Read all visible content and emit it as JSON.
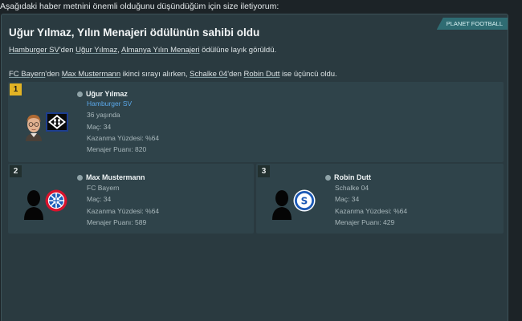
{
  "intro": "Aşağıdaki haber metnini önemli olduğunu düşündüğüm için size iletiyorum:",
  "source": "PLANET FOOTBALL",
  "headline": "Uğur Yılmaz, Yılın Menajeri ödülünün sahibi oldu",
  "para1": {
    "club": "Hamburger SV",
    "t1": "'den ",
    "manager": "Uğur Yılmaz",
    "t2": ", ",
    "award": "Almanya Yılın Menajeri",
    "t3": " ödülüne layık görüldü."
  },
  "para2": {
    "club1": "FC Bayern",
    "t1": "'den ",
    "manager1": "Max Mustermann",
    "t2": " ikinci sırayı alırken, ",
    "club2": "Schalke 04",
    "t3": "'den ",
    "manager2": "Robin Dutt",
    "t4": " ise üçüncü oldu."
  },
  "ranks": [
    {
      "rank": "1",
      "name": "Uğur Yılmaz",
      "club": "Hamburger SV",
      "age": "36 yaşında",
      "matches": "Maç: 34",
      "win_pct": "Kazanma Yüzdesi: %64",
      "rating": "Menajer Puanı: 820",
      "avatar_icon": "manager-face-icon",
      "crest_icon": "hamburger-sv-crest-icon"
    },
    {
      "rank": "2",
      "name": "Max Mustermann",
      "club": "FC Bayern",
      "matches": "Maç: 34",
      "win_pct": "Kazanma Yüzdesi: %64",
      "rating": "Menajer Puanı: 589",
      "avatar_icon": "silhouette-icon",
      "crest_icon": "fc-bayern-crest-icon"
    },
    {
      "rank": "3",
      "name": "Robin Dutt",
      "club": "Schalke 04",
      "matches": "Maç: 34",
      "win_pct": "Kazanma Yüzdesi: %64",
      "rating": "Menajer Puanı: 429",
      "avatar_icon": "silhouette-icon",
      "crest_icon": "schalke-04-crest-icon"
    }
  ],
  "colors": {
    "background": "#1c2327",
    "card": "#2a3a40",
    "panel": "#2f434a",
    "source_tag": "#2f6c73",
    "gold_badge": "#e3b324",
    "club_link": "#5aa7e8"
  }
}
